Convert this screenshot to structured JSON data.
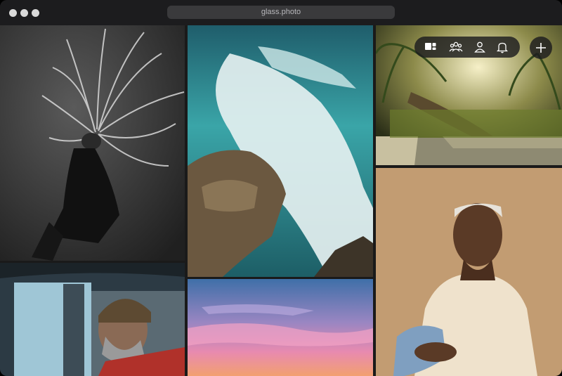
{
  "window": {
    "url": "glass.photo"
  },
  "toolbar": {
    "icons": [
      "gallery-icon",
      "people-icon",
      "profile-icon",
      "bell-icon"
    ],
    "add_icon": "plus-icon"
  },
  "photos": [
    "dancer-hair-monochrome",
    "ocean-waves-rocks",
    "sunlit-palm-grove",
    "woman-white-hair-portrait",
    "man-beanie-window",
    "pink-sunset-sky"
  ]
}
